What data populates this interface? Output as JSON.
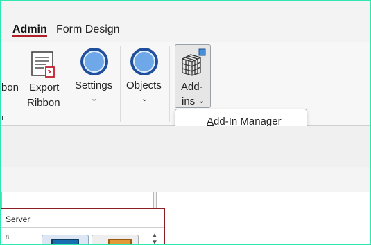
{
  "tabs": [
    {
      "label": "Admin",
      "active": true
    },
    {
      "label": "Form Design",
      "active": false
    }
  ],
  "ribbon": {
    "partial_label": "bon",
    "export": {
      "line1": "Export",
      "line2": "Ribbon"
    },
    "settings": {
      "label": "Settings"
    },
    "objects": {
      "label": "Objects"
    },
    "addins": {
      "line1": "Add-",
      "line2": "ins"
    }
  },
  "dropdown": {
    "item_label_underlined": "A",
    "item_label_rest": "dd-In Manager"
  },
  "dialog": {
    "title": "Server",
    "side_number": "8"
  },
  "colors": {
    "accent_red": "#b0202a",
    "frame_border": "#2ee8b0",
    "circle_blue": "#6ea8e8"
  },
  "icons": {
    "export": "export-ribbon-icon",
    "settings": "settings-circle-icon",
    "objects": "objects-circle-icon",
    "addins": "cube-grid-icon"
  }
}
